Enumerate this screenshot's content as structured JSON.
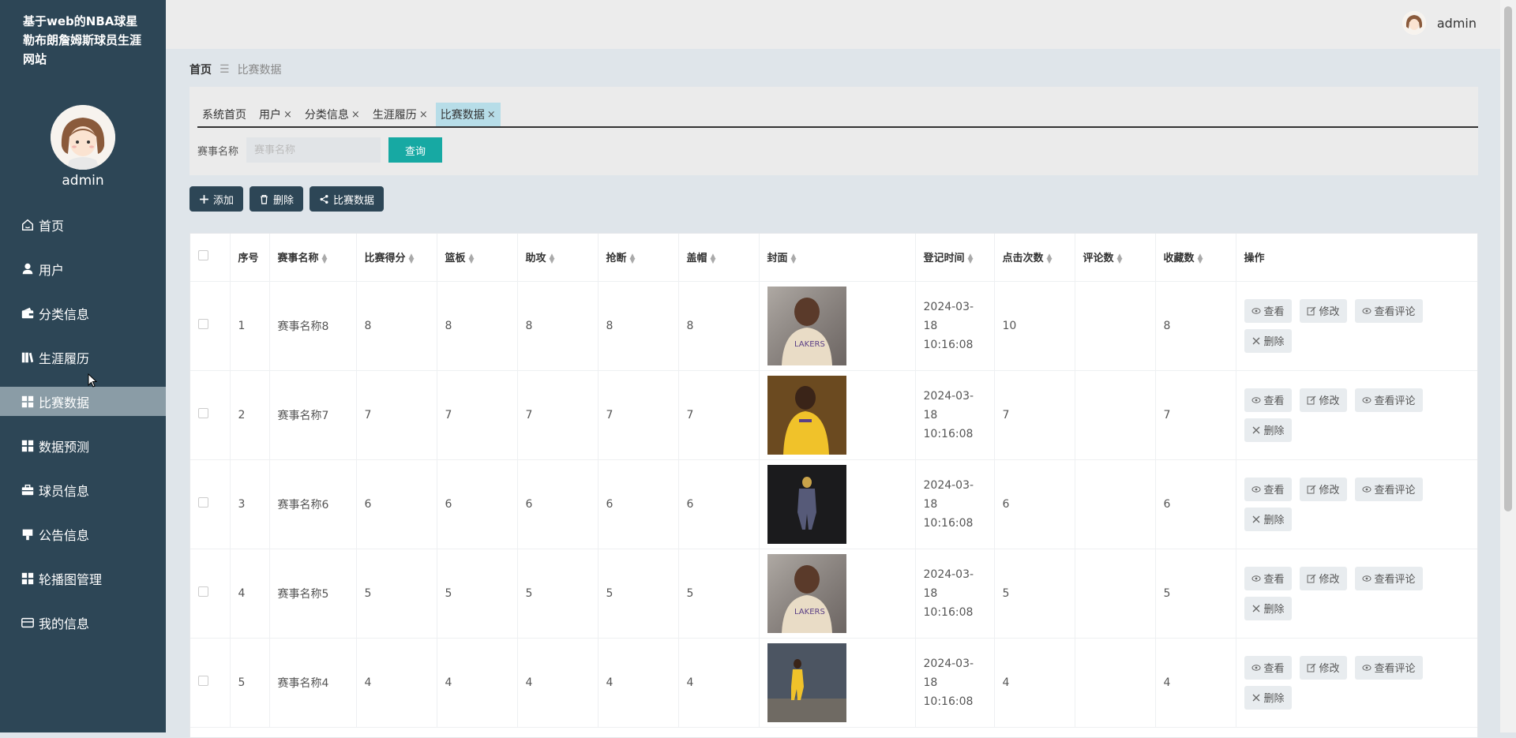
{
  "sidebar": {
    "title": "基于web的NBA球星勒布朗詹姆斯球员生涯网站",
    "username": "admin",
    "items": [
      {
        "label": "首页",
        "icon": "home-icon"
      },
      {
        "label": "用户",
        "icon": "user-icon"
      },
      {
        "label": "分类信息",
        "icon": "wallet-icon"
      },
      {
        "label": "生涯履历",
        "icon": "book-icon"
      },
      {
        "label": "比赛数据",
        "icon": "grid-icon",
        "active": true
      },
      {
        "label": "数据预测",
        "icon": "grid-icon"
      },
      {
        "label": "球员信息",
        "icon": "briefcase-icon"
      },
      {
        "label": "公告信息",
        "icon": "podium-icon"
      },
      {
        "label": "轮播图管理",
        "icon": "grid-icon"
      },
      {
        "label": "我的信息",
        "icon": "card-icon"
      }
    ]
  },
  "topbar": {
    "username": "admin"
  },
  "breadcrumb": {
    "home": "首页",
    "sep": "☰",
    "current": "比赛数据"
  },
  "tabs": [
    {
      "label": "系统首页",
      "closable": false
    },
    {
      "label": "用户",
      "closable": true
    },
    {
      "label": "分类信息",
      "closable": true
    },
    {
      "label": "生涯履历",
      "closable": true
    },
    {
      "label": "比赛数据",
      "closable": true,
      "active": true
    }
  ],
  "tab_close": "×",
  "search": {
    "label": "赛事名称",
    "placeholder": "赛事名称",
    "button": "查询"
  },
  "actions": {
    "add": "添加",
    "delete": "删除",
    "stats": "比赛数据"
  },
  "table": {
    "headers": [
      "序号",
      "赛事名称",
      "比赛得分",
      "篮板",
      "助攻",
      "抢断",
      "盖帽",
      "封面",
      "登记时间",
      "点击次数",
      "评论数",
      "收藏数",
      "操作"
    ],
    "rows": [
      {
        "no": "1",
        "name": "赛事名称8",
        "score": "8",
        "rebound": "8",
        "assist": "8",
        "steal": "8",
        "block": "8",
        "date": "2024-03-18",
        "time": "10:16:08",
        "clicks": "10",
        "comments": "",
        "favs": "8",
        "cover": "portrait-light"
      },
      {
        "no": "2",
        "name": "赛事名称7",
        "score": "7",
        "rebound": "7",
        "assist": "7",
        "steal": "7",
        "block": "7",
        "date": "2024-03-18",
        "time": "10:16:08",
        "clicks": "7",
        "comments": "",
        "favs": "7",
        "cover": "portrait-yellow"
      },
      {
        "no": "3",
        "name": "赛事名称6",
        "score": "6",
        "rebound": "6",
        "assist": "6",
        "steal": "6",
        "block": "6",
        "date": "2024-03-18",
        "time": "10:16:08",
        "clicks": "6",
        "comments": "",
        "favs": "6",
        "cover": "portrait-dark"
      },
      {
        "no": "4",
        "name": "赛事名称5",
        "score": "5",
        "rebound": "5",
        "assist": "5",
        "steal": "5",
        "block": "5",
        "date": "2024-03-18",
        "time": "10:16:08",
        "clicks": "5",
        "comments": "",
        "favs": "5",
        "cover": "portrait-light"
      },
      {
        "no": "5",
        "name": "赛事名称4",
        "score": "4",
        "rebound": "4",
        "assist": "4",
        "steal": "4",
        "block": "4",
        "date": "2024-03-18",
        "time": "10:16:08",
        "clicks": "4",
        "comments": "",
        "favs": "4",
        "cover": "portrait-court"
      }
    ],
    "row_actions": {
      "view": "查看",
      "edit": "修改",
      "comments": "查看评论",
      "delete": "删除"
    }
  },
  "colors": {
    "sidebar": "#2d4656",
    "active_menu": "#8a9ca6",
    "active_tab": "#b7dde8",
    "search_button": "#17a9a3"
  }
}
